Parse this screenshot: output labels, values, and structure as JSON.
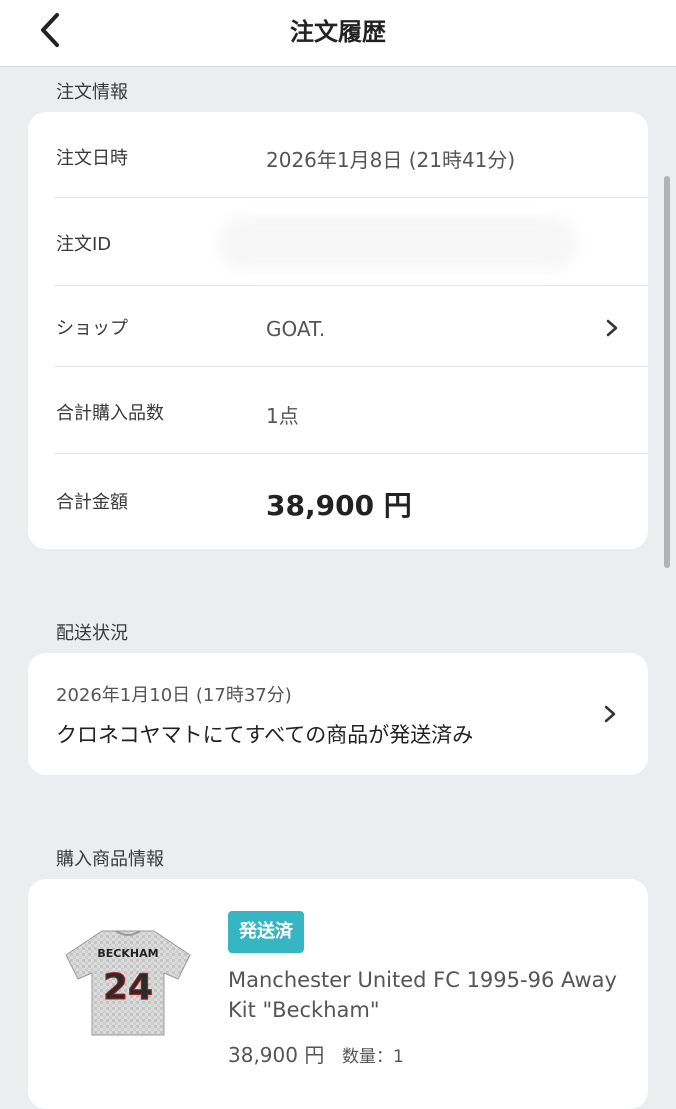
{
  "header": {
    "title": "注文履歴",
    "back_icon": "chevron-left-icon"
  },
  "order_info": {
    "section_label": "注文情報",
    "rows": [
      {
        "label": "注文日時",
        "value": "2026年1月8日 (21時41分)"
      },
      {
        "label": "注文ID",
        "value": ""
      },
      {
        "label": "ショップ",
        "value": "GOAT."
      },
      {
        "label": "合計購入品数",
        "value": "1点"
      },
      {
        "label": "合計金額",
        "value": "38,900 円"
      }
    ]
  },
  "shipping": {
    "section_label": "配送状況",
    "date": "2026年1月10日 (17時37分)",
    "status": "クロネコヤマトにてすべての商品が発送済み"
  },
  "products": {
    "section_label": "購入商品情報",
    "items": [
      {
        "badge": "発送済",
        "name": "Manchester United FC 1995-96 Away Kit \"Beckham\"",
        "price": "38,900 円",
        "qty_label": "数量：1",
        "image": {
          "player_name": "BECKHAM",
          "number": "24"
        }
      }
    ]
  },
  "colors": {
    "background": "#ecedee",
    "card": "#ffffff",
    "badge": "#36b6c3",
    "text_primary": "#222222",
    "text_secondary": "#555555"
  }
}
